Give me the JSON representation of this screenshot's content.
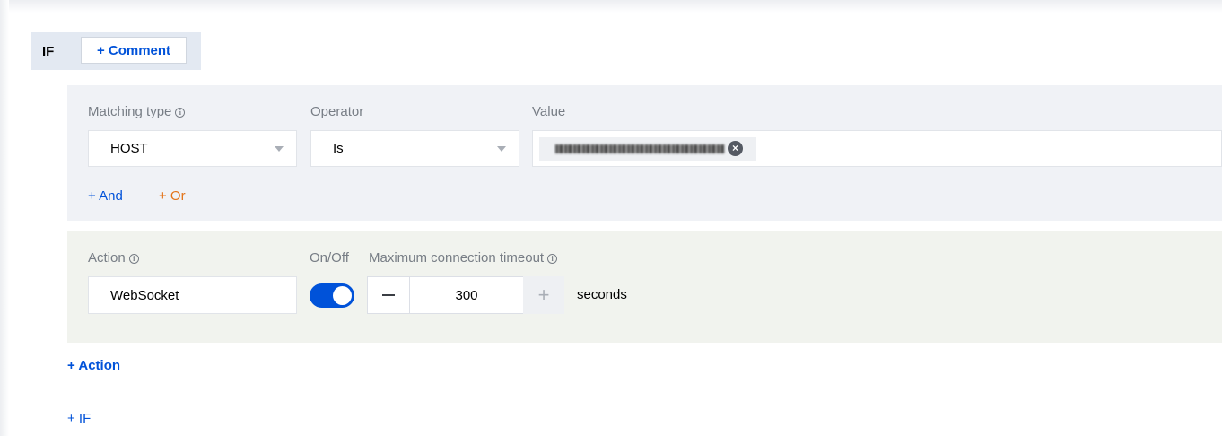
{
  "if_block": {
    "label": "IF",
    "comment_button": "+ Comment"
  },
  "condition": {
    "matching_type_label": "Matching type",
    "operator_label": "Operator",
    "value_label": "Value",
    "matching_type_value": "HOST",
    "operator_value": "Is",
    "value_tag_close": "×",
    "and_link": "+ And",
    "or_link": "+ Or"
  },
  "action": {
    "action_label": "Action",
    "onoff_label": "On/Off",
    "timeout_label": "Maximum connection timeout",
    "action_value": "WebSocket",
    "toggle_on": true,
    "timeout_value": "300",
    "minus_symbol": "",
    "plus_symbol": "+",
    "unit": "seconds"
  },
  "add_action_link": "+ Action",
  "add_if_link": "+ IF",
  "info_symbol": "i",
  "colors": {
    "accent": "#0052d9",
    "or_link": "#e37318",
    "condition_bg": "#f0f2f6",
    "action_bg": "#f1f3ee"
  }
}
